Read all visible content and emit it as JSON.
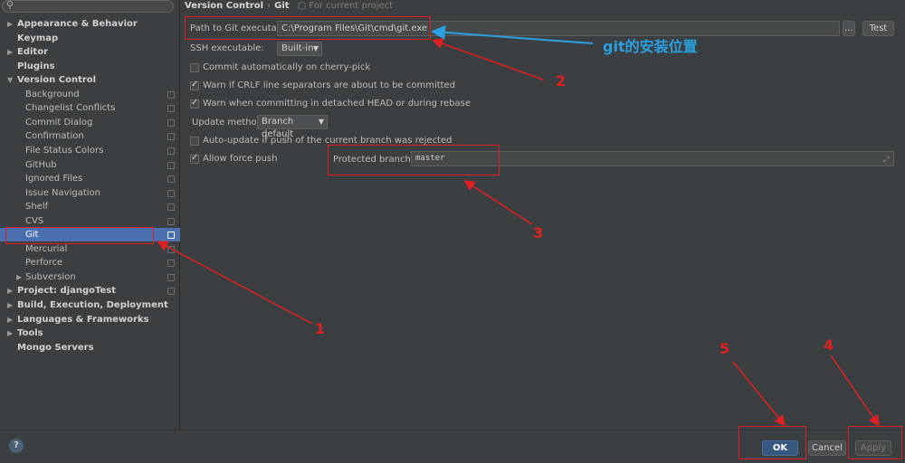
{
  "search": {
    "placeholder": ""
  },
  "sidebar": {
    "items": [
      {
        "label": "Appearance & Behavior",
        "bold": true,
        "arrow": "right",
        "indent": 0
      },
      {
        "label": "Keymap",
        "bold": true,
        "indent": 0
      },
      {
        "label": "Editor",
        "bold": true,
        "arrow": "right",
        "indent": 0
      },
      {
        "label": "Plugins",
        "bold": true,
        "indent": 0
      },
      {
        "label": "Version Control",
        "bold": true,
        "arrow": "down",
        "indent": 0
      },
      {
        "label": "Background",
        "indent": 1,
        "project": true
      },
      {
        "label": "Changelist Conflicts",
        "indent": 1,
        "project": true
      },
      {
        "label": "Commit Dialog",
        "indent": 1,
        "project": true
      },
      {
        "label": "Confirmation",
        "indent": 1,
        "project": true
      },
      {
        "label": "File Status Colors",
        "indent": 1,
        "project": true
      },
      {
        "label": "GitHub",
        "indent": 1,
        "project": true
      },
      {
        "label": "Ignored Files",
        "indent": 1,
        "project": true
      },
      {
        "label": "Issue Navigation",
        "indent": 1,
        "project": true
      },
      {
        "label": "Shelf",
        "indent": 1,
        "project": true
      },
      {
        "label": "CVS",
        "indent": 1,
        "project": true
      },
      {
        "label": "Git",
        "indent": 1,
        "project": true,
        "selected": true
      },
      {
        "label": "Mercurial",
        "indent": 1,
        "project": true
      },
      {
        "label": "Perforce",
        "indent": 1,
        "project": true
      },
      {
        "label": "Subversion",
        "indent": 1,
        "arrow": "right",
        "project": true
      },
      {
        "label": "Project: djangoTest",
        "bold": true,
        "arrow": "right",
        "indent": 0,
        "project": true
      },
      {
        "label": "Build, Execution, Deployment",
        "bold": true,
        "arrow": "right",
        "indent": 0
      },
      {
        "label": "Languages & Frameworks",
        "bold": true,
        "arrow": "right",
        "indent": 0
      },
      {
        "label": "Tools",
        "bold": true,
        "arrow": "right",
        "indent": 0
      },
      {
        "label": "Mongo Servers",
        "bold": true,
        "indent": 0
      }
    ]
  },
  "breadcrumb": {
    "section": "Version Control",
    "separator": "›",
    "page": "Git",
    "scope": "For current project"
  },
  "git": {
    "path_label": "Path to Git executable:",
    "path_value": "C:\\Program Files\\Git\\cmd\\git.exe",
    "browse_label": "...",
    "test_label": "Test",
    "ssh_label": "SSH executable:",
    "ssh_value": "Built-in",
    "commit_cherry_pick": {
      "label": "Commit automatically on cherry-pick",
      "checked": false
    },
    "warn_crlf": {
      "label": "Warn if CRLF line separators are about to be committed",
      "checked": true
    },
    "warn_detached": {
      "label": "Warn when committing in detached HEAD or during rebase",
      "checked": true
    },
    "update_method_label": "Update method:",
    "update_method_value": "Branch default",
    "auto_update": {
      "label": "Auto-update if push of the current branch was rejected",
      "checked": false
    },
    "allow_force_push": {
      "label": "Allow force push",
      "checked": true
    },
    "protected_label": "Protected branches:",
    "protected_value": "master"
  },
  "buttons": {
    "ok": "OK",
    "cancel": "Cancel",
    "apply": "Apply",
    "help": "?"
  },
  "annotations": {
    "note": "git的安装位置",
    "n1": "1",
    "n2": "2",
    "n3": "3",
    "n4": "4",
    "n5": "5",
    "red": "#e02020",
    "blue": "#2aa0e0"
  },
  "colors": {
    "selection": "#4b6eaf",
    "background": "#3c3f41",
    "ok_button": "#365880"
  }
}
